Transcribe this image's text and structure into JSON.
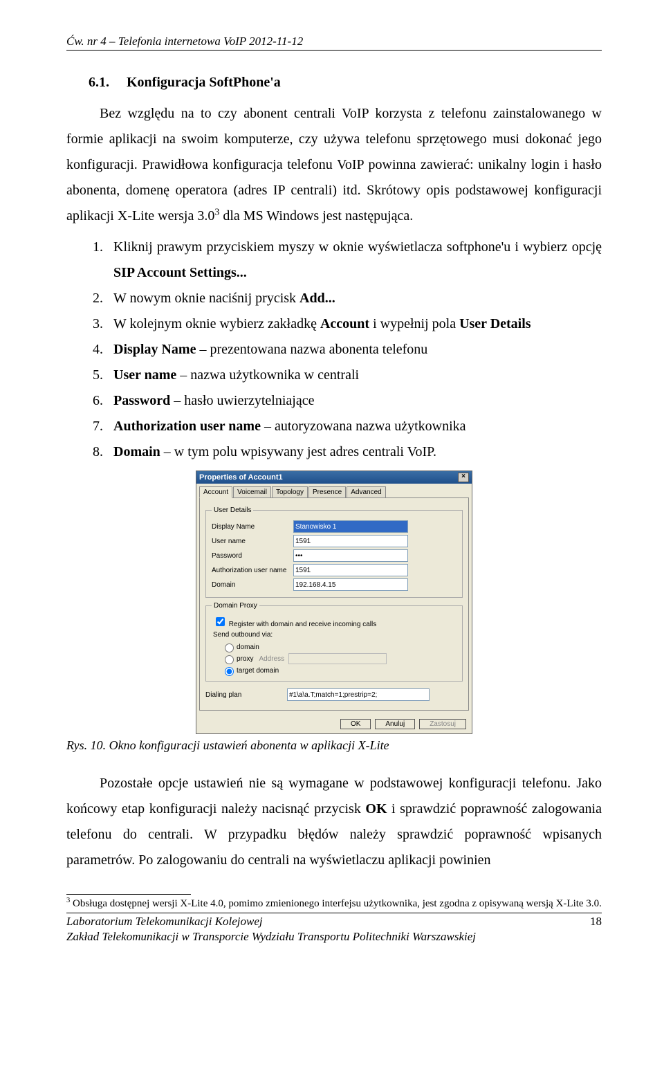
{
  "header": "Ćw. nr 4 – Telefonia internetowa VoIP 2012-11-12",
  "section": {
    "num": "6.1.",
    "title": "Konfiguracja SoftPhone'a"
  },
  "para1": "Bez względu na to czy abonent centrali VoIP korzysta z telefonu zainstalowanego w formie aplikacji na swoim komputerze, czy używa telefonu sprzętowego musi dokonać jego konfiguracji. Prawidłowa konfiguracja telefonu VoIP powinna zawierać: unikalny login i hasło abonenta, domenę operatora (adres IP centrali) itd. Skrótowy opis podstawowej konfiguracji aplikacji X-Lite wersja 3.0",
  "sup1": "3",
  "para1_tail": " dla MS Windows jest następująca.",
  "steps": [
    {
      "pre": "Kliknij prawym przyciskiem myszy w oknie wyświetlacza softphone'u i wybierz opcję ",
      "b": "SIP Account Settings...",
      "post": ""
    },
    {
      "pre": "W nowym oknie naciśnij prycisk ",
      "b": "Add...",
      "post": ""
    },
    {
      "pre": "W kolejnym oknie wybierz zakładkę ",
      "b": "Account",
      "mid": " i wypełnij pola ",
      "b2": "User Details",
      "post": ""
    },
    {
      "b": "Display Name",
      "post": " – prezentowana nazwa abonenta telefonu"
    },
    {
      "b": "User name",
      "post": " – nazwa użytkownika w centrali"
    },
    {
      "b": "Password",
      "post": " – hasło uwierzytelniające"
    },
    {
      "b": "Authorization user name",
      "post": " – autoryzowana nazwa użytkownika"
    },
    {
      "b": "Domain",
      "post": " – w tym polu wpisywany jest adres centrali VoIP."
    }
  ],
  "dialog": {
    "title": "Properties of Account1",
    "tabs": [
      "Account",
      "Voicemail",
      "Topology",
      "Presence",
      "Advanced"
    ],
    "activeTab": 0,
    "userDetailsLegend": "User Details",
    "fields": {
      "displayName": {
        "label": "Display Name",
        "value": "Stanowisko 1"
      },
      "userName": {
        "label": "User name",
        "value": "1591"
      },
      "password": {
        "label": "Password",
        "value": "•••"
      },
      "authUser": {
        "label": "Authorization user name",
        "value": "1591"
      },
      "domain": {
        "label": "Domain",
        "value": "192.168.4.15"
      }
    },
    "domainProxyLegend": "Domain Proxy",
    "registerCb": "Register with domain and receive incoming calls",
    "sendVia": "Send outbound via:",
    "radios": {
      "domain": "domain",
      "proxy": "proxy",
      "proxyAddr": "Address",
      "target": "target domain"
    },
    "dialingPlan": {
      "label": "Dialing plan",
      "value": "#1\\a\\a.T;match=1;prestrip=2;"
    },
    "buttons": {
      "ok": "OK",
      "cancel": "Anuluj",
      "apply": "Zastosuj"
    }
  },
  "caption": "Rys. 10. Okno konfiguracji ustawień abonenta w aplikacji X-Lite",
  "para2_a": "Pozostałe opcje ustawień nie są wymagane w podstawowej konfiguracji telefonu. Jako końcowy etap konfiguracji należy nacisnąć przycisk ",
  "para2_b": "OK",
  "para2_c": " i sprawdzić poprawność zalogowania telefonu do centrali. W przypadku błędów należy sprawdzić poprawność wpisanych parametrów. Po zalogowaniu do centrali na wyświetlaczu aplikacji powinien",
  "footnote": {
    "num": "3",
    "text": " Obsługa dostępnej wersji X-Lite 4.0, pomimo zmienionego interfejsu użytkownika, jest zgodna z opisywaną wersją X-Lite 3.0."
  },
  "footer1": "Laboratorium Telekomunikacji Kolejowej",
  "pageNum": "18",
  "footer2": "Zakład Telekomunikacji w Transporcie Wydziału Transportu Politechniki Warszawskiej"
}
